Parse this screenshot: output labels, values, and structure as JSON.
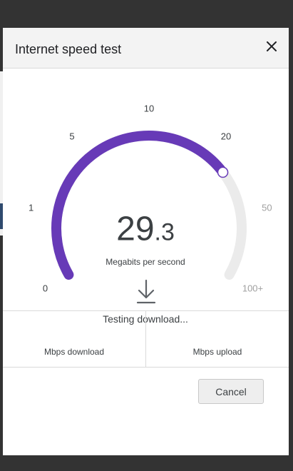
{
  "dialog": {
    "title": "Internet speed test",
    "close_icon": "close-icon"
  },
  "gauge": {
    "ticks": [
      {
        "label": "0",
        "dim": false
      },
      {
        "label": "1",
        "dim": false
      },
      {
        "label": "5",
        "dim": false
      },
      {
        "label": "10",
        "dim": false
      },
      {
        "label": "20",
        "dim": false
      },
      {
        "label": "50",
        "dim": true
      },
      {
        "label": "100+",
        "dim": true
      }
    ],
    "progress_fraction": 0.72,
    "fill_color": "#673ab7",
    "track_color": "#ebebeb"
  },
  "speed": {
    "integer": "29",
    "decimal": ".3",
    "unit": "Megabits per second"
  },
  "status": {
    "icon": "download-arrow-icon",
    "text": "Testing download..."
  },
  "results": {
    "download_label": "Mbps download",
    "upload_label": "Mbps upload"
  },
  "actions": {
    "cancel_label": "Cancel"
  }
}
